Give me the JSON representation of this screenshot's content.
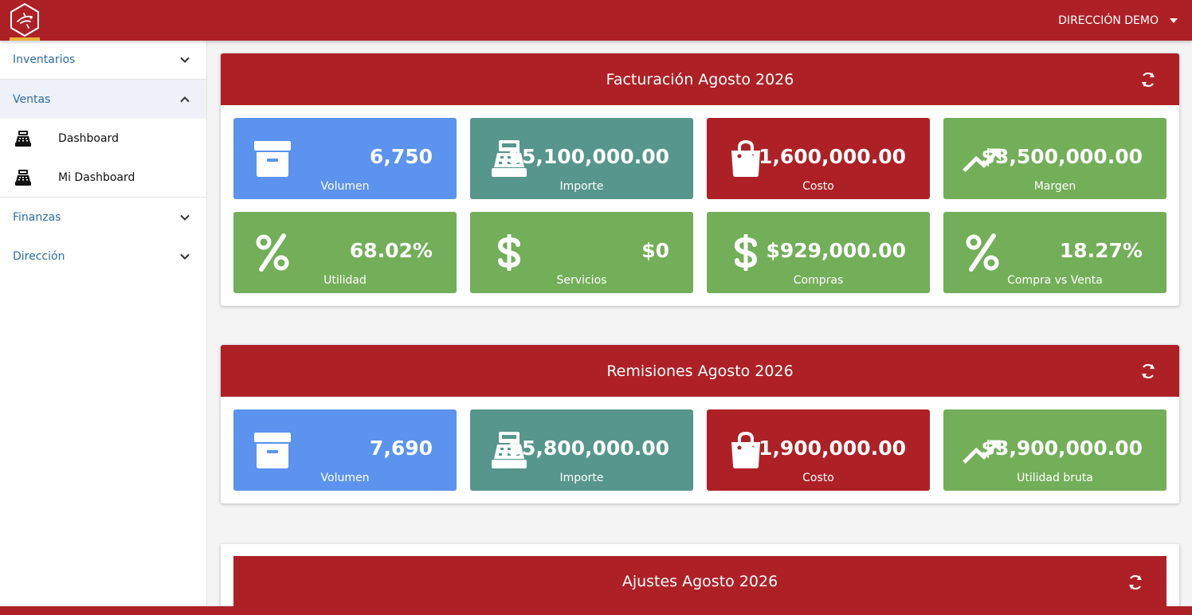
{
  "colors": {
    "brand": "#ad2126",
    "blue": "#5b93ee",
    "teal": "#56968c",
    "red": "#ad2126",
    "green": "#73ae59",
    "link": "#2e6da4"
  },
  "header": {
    "user_label": "DIRECCIÓN DEMO"
  },
  "sidebar": {
    "sections": [
      {
        "label": "Inventarios",
        "state": "collapsed"
      },
      {
        "label": "Ventas",
        "state": "expanded",
        "items": [
          {
            "label": "Dashboard",
            "icon": "cash-register-icon"
          },
          {
            "label": "Mi Dashboard",
            "icon": "cash-register-icon"
          }
        ]
      },
      {
        "label": "Finanzas",
        "state": "collapsed"
      },
      {
        "label": "Dirección",
        "state": "collapsed"
      }
    ]
  },
  "panels": [
    {
      "title": "Facturación Agosto 2026",
      "cards": [
        {
          "value": "6,750",
          "label": "Volumen",
          "icon": "archive-icon",
          "color": "blue"
        },
        {
          "value": "$5,100,000.00",
          "label": "Importe",
          "icon": "cash-register-icon",
          "color": "teal"
        },
        {
          "value": "$1,600,000.00",
          "label": "Costo",
          "icon": "shopping-bag-icon",
          "color": "red"
        },
        {
          "value": "$3,500,000.00",
          "label": "Margen",
          "icon": "trending-up-icon",
          "color": "green"
        },
        {
          "value": "68.02%",
          "label": "Utilidad",
          "icon": "percent-icon",
          "color": "green"
        },
        {
          "value": "$0",
          "label": "Servicios",
          "icon": "dollar-icon",
          "color": "green"
        },
        {
          "value": "$929,000.00",
          "label": "Compras",
          "icon": "dollar-icon",
          "color": "green"
        },
        {
          "value": "18.27%",
          "label": "Compra vs Venta",
          "icon": "percent-icon",
          "color": "green"
        }
      ]
    },
    {
      "title": "Remisiones Agosto 2026",
      "cards": [
        {
          "value": "7,690",
          "label": "Volumen",
          "icon": "archive-icon",
          "color": "blue"
        },
        {
          "value": "$5,800,000.00",
          "label": "Importe",
          "icon": "cash-register-icon",
          "color": "teal"
        },
        {
          "value": "$1,900,000.00",
          "label": "Costo",
          "icon": "shopping-bag-icon",
          "color": "red"
        },
        {
          "value": "$3,900,000.00",
          "label": "Utilidad bruta",
          "icon": "trending-up-icon",
          "color": "green"
        }
      ]
    },
    {
      "title": "Ajustes Agosto 2026"
    }
  ]
}
